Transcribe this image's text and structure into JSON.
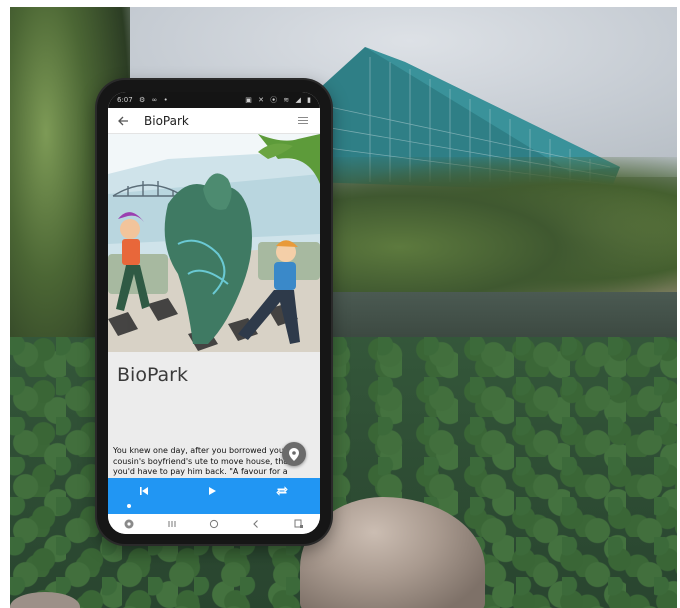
{
  "statusbar": {
    "time": "6:07",
    "left_icons": [
      "settings-icon",
      "voicemail-icon",
      "dot-icon"
    ],
    "right_icons": [
      "vibrate-icon",
      "mute-icon",
      "location-icon",
      "wifi-icon",
      "signal-icon",
      "battery-icon"
    ]
  },
  "appbar": {
    "title": "BioPark"
  },
  "story": {
    "title": "BioPark",
    "text": "You knew one day, after you borrowed your cousin's boyfriend's ute to move house, that you'd have to pay him back. \"A favour for a favour,\" he'd"
  },
  "player": {
    "controls": [
      "skip-previous-icon",
      "play-icon",
      "repeat-icon"
    ]
  },
  "navbar": {
    "icons": [
      "assistant-icon",
      "recents-icon",
      "home-icon",
      "back-icon",
      "screenshot-icon"
    ]
  },
  "colors": {
    "player_bar": "#2196f3",
    "content_bg": "#ececec",
    "phone_frame": "#161616"
  }
}
